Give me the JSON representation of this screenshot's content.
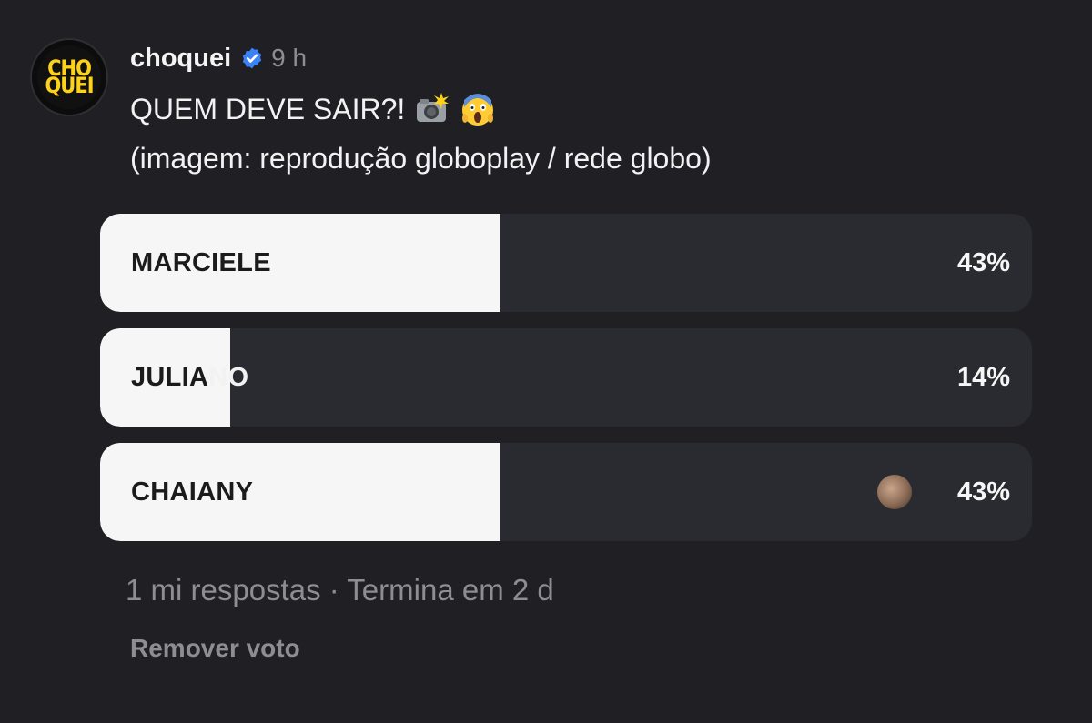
{
  "post": {
    "avatar_logo_lines": [
      "CHO",
      "QUEI"
    ],
    "username": "choquei",
    "verified_icon": "verified-badge-icon",
    "verified_color": "#3b82f6",
    "time": "9 h",
    "caption_line1": "QUEM DEVE SAIR?!",
    "caption_emojis": [
      "camera-flash-emoji",
      "screaming-face-emoji"
    ],
    "caption_line2": "(imagem: reprodução globoplay / rede globo)"
  },
  "poll": {
    "options": [
      {
        "label": "MARCIELE",
        "percent": "43%",
        "fill_fraction": 0.43
      },
      {
        "label_dark": "JULIA",
        "label_light": "NO",
        "label": "JULIANO",
        "percent": "14%",
        "fill_fraction": 0.14
      },
      {
        "label": "CHAIANY",
        "percent": "43%",
        "fill_fraction": 0.43,
        "user_voted": true
      }
    ],
    "meta": "1 mi respostas · Termina em 2 d",
    "remove_vote": "Remover voto"
  },
  "colors": {
    "background": "#1f1f24",
    "bar_track": "#2a2b31",
    "bar_fill": "#f6f6f6",
    "muted_text": "#8d8d93",
    "logo_yellow": "#ffd21a"
  }
}
